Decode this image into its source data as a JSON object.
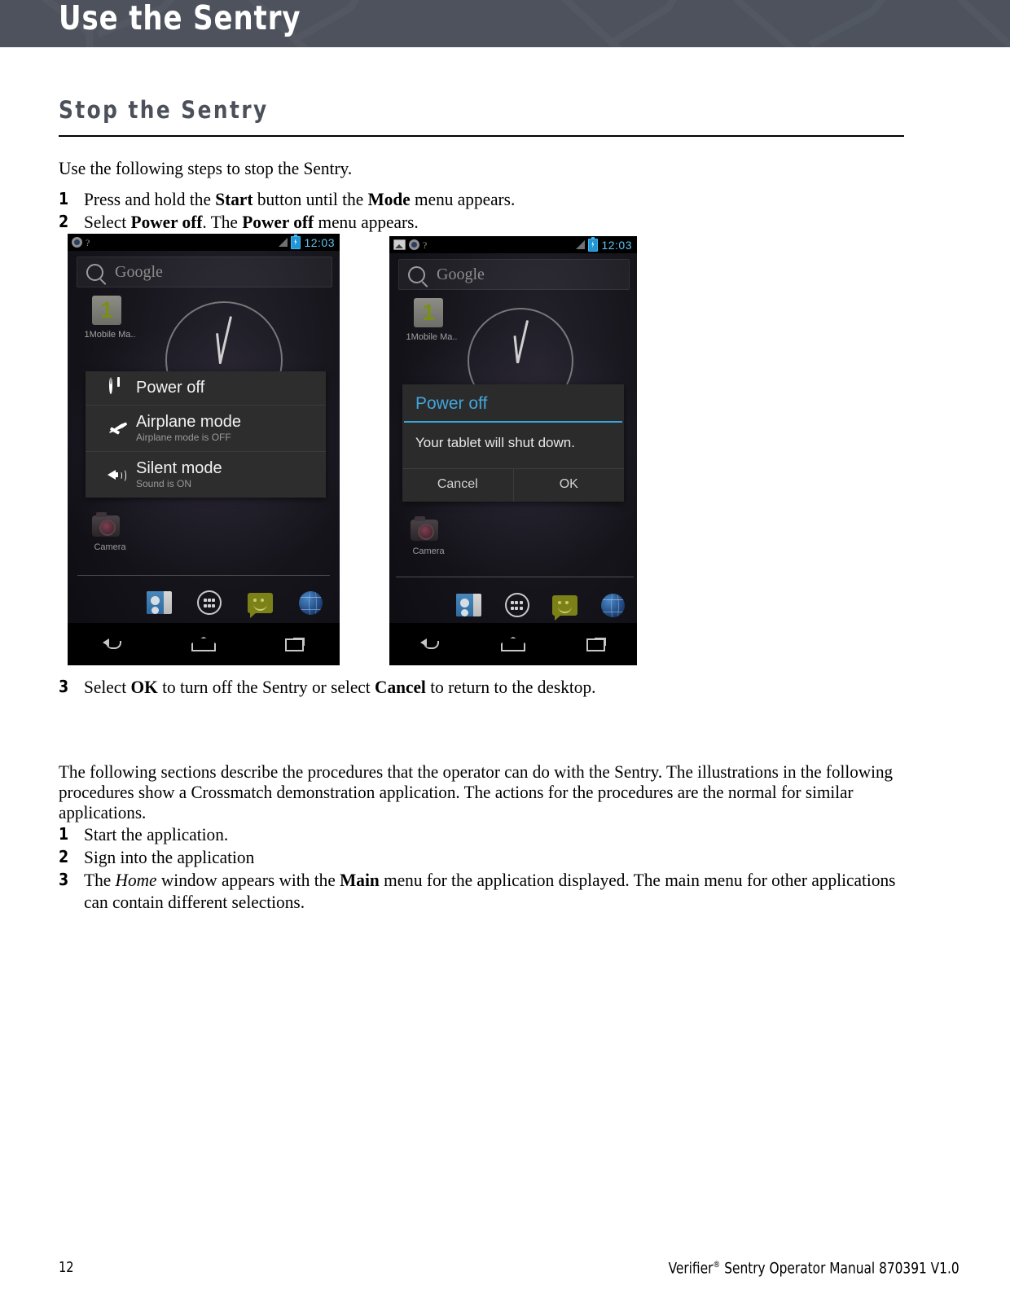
{
  "header": {
    "title": "Use the Sentry"
  },
  "section": {
    "heading": "Stop the Sentry",
    "intro": "Use the following steps to stop the Sentry."
  },
  "steps_stop": [
    {
      "num": "1",
      "html": "Press and hold the <b>Start</b> button until the <b>Mode</b> menu appears."
    },
    {
      "num": "2",
      "html": "Select <b>Power off</b>. The <b>Power off</b> menu appears."
    }
  ],
  "steps_stop_after": [
    {
      "num": "3",
      "html": "Select <b>OK</b> to turn off the Sentry or select <b>Cancel</b> to return to the desktop."
    }
  ],
  "paragraph": "The following sections describe the procedures that the operator can do with the Sentry. The illustrations in the following procedures show a Crossmatch demonstration application. The actions for the procedures are the normal for similar applications.",
  "steps_app": [
    {
      "num": "1",
      "html": "Start the application."
    },
    {
      "num": "2",
      "html": "Sign into the application"
    },
    {
      "num": "3",
      "html": "The <i>Home</i> window appears with the <b>Main</b> menu for the application displayed. The main menu for other applications can contain different selections."
    }
  ],
  "phone_1": {
    "statusbar": {
      "icons": [
        "sync-icon",
        "help-icon"
      ],
      "signal_icon": "signal-triangle-icon",
      "battery_icon": "battery-charging-icon",
      "time": "12:03"
    },
    "search_placeholder": "Google",
    "apps": [
      {
        "label": "1Mobile Ma..",
        "badge": "1"
      },
      {
        "label": "Camera"
      }
    ],
    "power_menu": [
      {
        "icon": "power-icon",
        "title": "Power off",
        "subtitle": ""
      },
      {
        "icon": "airplane-icon",
        "title": "Airplane mode",
        "subtitle": "Airplane mode is OFF"
      },
      {
        "icon": "sound-icon",
        "title": "Silent mode",
        "subtitle": "Sound is ON"
      }
    ],
    "dock": [
      "people-icon",
      "app-drawer-icon",
      "messaging-icon",
      "browser-icon"
    ],
    "navbar": [
      "back-icon",
      "home-icon",
      "recents-icon"
    ]
  },
  "phone_2": {
    "statusbar": {
      "icons": [
        "image-icon",
        "sync-icon",
        "help-icon"
      ],
      "signal_icon": "signal-triangle-icon",
      "battery_icon": "battery-charging-icon",
      "time": "12:03"
    },
    "search_placeholder": "Google",
    "apps": [
      {
        "label": "1Mobile Ma..",
        "badge": "1"
      },
      {
        "label": "Camera"
      }
    ],
    "dialog": {
      "title": "Power off",
      "message": "Your tablet will shut down.",
      "cancel": "Cancel",
      "ok": "OK"
    },
    "dock": [
      "people-icon",
      "app-drawer-icon",
      "messaging-icon",
      "browser-icon"
    ],
    "navbar": [
      "back-icon",
      "home-icon",
      "recents-icon"
    ]
  },
  "footer": {
    "page_number": "12",
    "manual_prefix": "Verifier",
    "manual_mark": "®",
    "manual_suffix": " Sentry Operator Manual 870391 V1.0"
  },
  "colors": {
    "header_band": "#4d525c",
    "heading_text": "#4b505a",
    "android_accent": "#42a5dc",
    "status_time": "#5ec4ee"
  }
}
